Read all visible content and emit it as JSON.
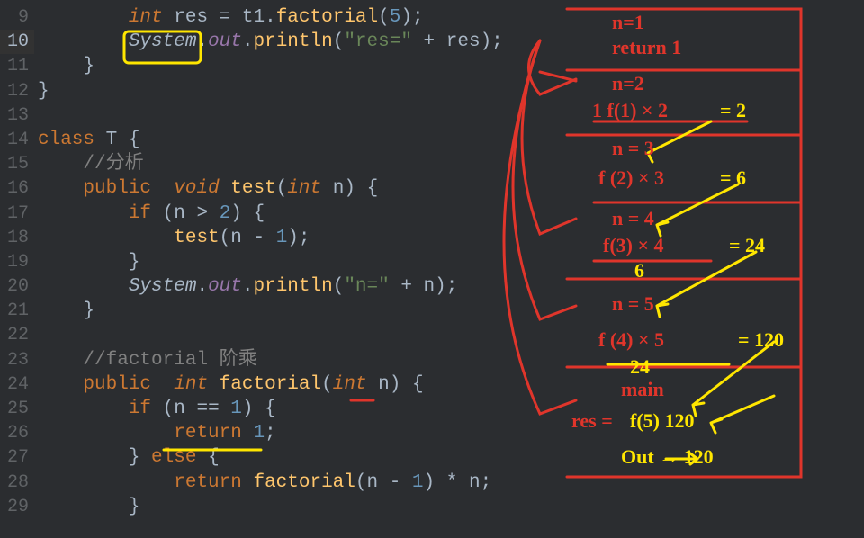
{
  "gutter": {
    "start": 9,
    "end": 29,
    "active": 10
  },
  "tokens": {
    "k_int": "int",
    "k_void": "void",
    "k_public": "public",
    "k_class": "class",
    "k_if": "if",
    "k_else": "else",
    "k_return": "return",
    "cls_T": "T",
    "fn_factorial_call": "factorial",
    "fn_println": "println",
    "fn_test": "test",
    "fn_factorial": "factorial",
    "v_res": "res",
    "v_t1": "t1",
    "v_n": "n",
    "field_out": "out",
    "cls_System": "System",
    "n5": "5",
    "n2": "2",
    "n1": "1",
    "str_res": "\"res=\"",
    "str_n": "\"n=\"",
    "cmt_analysis": "//分析",
    "cmt_factorial": "//factorial 阶乘",
    "dot": ".",
    "eq": " = ",
    "plus": " + ",
    "semi": ";",
    "lp": "(",
    "rp": ")",
    "lb": "{",
    "rb": "}",
    "gt": " > ",
    "eqeq": " == ",
    "minus": " - ",
    "star": " * "
  },
  "annotations": {
    "n1": "n=1",
    "return1": "return 1",
    "n2_lbl": "n=2",
    "f1x2": "1 f(1) × 2",
    "eq2": "= 2",
    "n3": "n = 3",
    "f2x3": "f (2) × 3",
    "eq6": "= 6",
    "n4": "n = 4",
    "f3x4": "f(3) × 4",
    "eq24": "= 24",
    "under6": "6",
    "n5_lbl": "n = 5",
    "f4x5": "f (4)  × 5",
    "eq120": "= 120",
    "under24": "24",
    "main": "main",
    "res_eq": "res =",
    "f5_120": "f(5)   120",
    "out120": "Out → 120"
  }
}
